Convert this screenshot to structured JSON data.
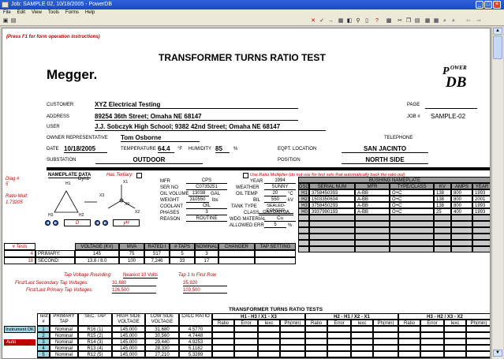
{
  "window": {
    "title": "Job: SAMPLE 02, 10/18/2005 - PowerDB"
  },
  "menu": [
    "File",
    "Edit",
    "View",
    "Tools",
    "Forms",
    "Help"
  ],
  "form": {
    "instructions": "(Press F1 for form operation instructions)",
    "brand": "Megger.",
    "title": "TRANSFORMER TURNS RATIO TEST",
    "page_label": "PAGE",
    "jobno_label": "JOB #",
    "jobno": "SAMPLE-02",
    "customer_label": "CUSTOMER",
    "customer": "XYZ Electrical Testing",
    "address_label": "ADDRESS",
    "address": "89254 36th Street;  Omaha NE 68147",
    "user_label": "USER",
    "user": "J.J. Sobczyk High School; 9382 42nd Street;  Omaha NE 68147",
    "owner_label": "OWNER REPRESENTATIVE",
    "owner": "Tom Osborne",
    "telephone_label": "TELEPHONE",
    "date_label": "DATE",
    "date": "10/18/2005",
    "temp_label": "TEMPERATURE",
    "temp": "64.4",
    "temp_unit": "°F",
    "humidity_label": "HUMIDITY",
    "humidity": "85",
    "humidity_unit": "%",
    "eqpt_label": "EQPT. LOCATION",
    "eqpt": "SAN JACINTO",
    "substation_label": "SUBSTATION",
    "substation": "OUTDOOR",
    "position_label": "POSITION",
    "position": "NORTH SIDE"
  },
  "nameplate": {
    "header": "NAMEPLATE DATA",
    "has_tertiary": "Has Tertiary:",
    "diag_label": "Diag #:",
    "diag": "5",
    "ratio_mult_label": "Ratio Mult:",
    "ratio_mult": "1.73205",
    "dyn": "Dyn1",
    "x1": "X1",
    "x2": "X2",
    "x3": "X3",
    "x0": "X0",
    "h1": "H1",
    "h2": "H2",
    "h3": "H3",
    "conn_left": "D",
    "conn_right": "yH",
    "fields": [
      {
        "label": "MFR",
        "value": "CPS"
      },
      {
        "label": "SER NO",
        "value": "C0735251"
      },
      {
        "label": "OIL VOLUME",
        "value": "13038",
        "unit": "GAL"
      },
      {
        "label": "WEIGHT",
        "value": "310550",
        "unit": "lbs"
      },
      {
        "label": "COOLANT",
        "value": "OIL"
      },
      {
        "label": "PHASES",
        "value": "3"
      },
      {
        "label": "REASON",
        "value": "ROUTINE"
      }
    ],
    "fields2": [
      {
        "label": "YEAR",
        "value": "1994"
      },
      {
        "label": "WEATHER",
        "value": "SUNNY"
      },
      {
        "label": "OIL TEMP",
        "value": "20",
        "unit": "°C"
      },
      {
        "label": "BIL",
        "value": "550",
        "unit": "kV"
      },
      {
        "label": "TANK TYPE",
        "value": "SEALED-CONSER."
      },
      {
        "label": "CLASS",
        "value": "OA/FOA/FOA"
      },
      {
        "label": "WDG MATERIAL",
        "value": "Cu"
      },
      {
        "label": "ALLOWED ERR",
        "value": "5",
        "unit": "%"
      }
    ],
    "ratio_mult_note": "Use Ratio Multiplier (do not use for test sets that automatically back the ratio out)"
  },
  "bushing": {
    "title": "BUSHING NAMEPLATE",
    "headers": [
      "DSG",
      "SERIAL NUM",
      "MFR",
      "TYPE/CLASS",
      "KV",
      "AMPS",
      "YEAR"
    ],
    "rows": [
      [
        "H1",
        "3758450393",
        "A-BB",
        "O+C",
        "138",
        "800",
        "1993"
      ],
      [
        "H2",
        "1503350604",
        "A-BB",
        "O+C",
        "138",
        "800",
        "2001"
      ],
      [
        "H3",
        "3758450293",
        "A-BB",
        "O+C",
        "138",
        "800",
        "1993"
      ],
      [
        "H0",
        "3937990193",
        "A-BB",
        "O+C",
        "25",
        "400",
        "1993"
      ]
    ]
  },
  "tests_table": {
    "headers": [
      "# Tests",
      "VOLTAGE (KV)",
      "MVA",
      "RATED I",
      "# TAPS",
      "NOMINAL",
      "CHANGER",
      "TAP SETTING"
    ],
    "rows": [
      [
        "4",
        "PRIMARY:",
        "145",
        "75",
        "517",
        "5",
        "3",
        ""
      ],
      [
        "18",
        "SECOND:",
        "13.8  /  8.0",
        "100",
        "7,246",
        "33",
        "17",
        ""
      ]
    ]
  },
  "tap": {
    "rounding_label": "Tap Voltage Rounding:",
    "rounding": "Nearest  10  Volts",
    "tap1_label": "Tap 1 Is First Row",
    "secondary_label": "First/Last Secondary Tap Voltages:",
    "sec_first": "31,680",
    "sec_last": "25,920",
    "primary_label": "First/Last Primary Tap Voltages:",
    "pri_first": "126,500",
    "pri_last": "103,500"
  },
  "ttr": {
    "title": "TRANSFORMER TURNS RATIO TESTS",
    "col_headers": [
      "Test #",
      "PRIMARY TAP",
      "SEC. TAP",
      "HIGH SIDE VOLTAGE",
      "LOW SIDE VOLTAGE",
      "CALC RATIO"
    ],
    "phase_groups": [
      "H1 - H3 / X1 - X3",
      "H2 - H1 / X2 - X1",
      "H3 - H2 / X3 - X2"
    ],
    "sub_headers": [
      "Ratio",
      "Error",
      "Iexc",
      "Ph(min)"
    ],
    "instrument": "Instrument OK",
    "auto": "Auto",
    "rows": [
      [
        "1",
        "Nominal",
        "R16 (1)",
        "145,000",
        "31,680",
        "4.5770"
      ],
      [
        "2",
        "Nominal",
        "R15 (2)",
        "145,000",
        "30,560",
        "4.7448"
      ],
      [
        "3",
        "Nominal",
        "R14 (3)",
        "145,000",
        "29,440",
        "4.9253"
      ],
      [
        "4",
        "Nominal",
        "R13 (4)",
        "145,000",
        "28,330",
        "5.1182"
      ],
      [
        "5",
        "Nominal",
        "R12 (5)",
        "145,000",
        "27,210",
        "5.3289"
      ],
      [
        "6",
        "Nominal",
        "R11 (6)",
        "145,000",
        "26,090",
        "5.5577"
      ],
      [
        "7",
        "Nominal",
        "R10 (7)",
        "145,000",
        "24,970",
        "5.8070"
      ]
    ]
  },
  "colors": {
    "accent": "#c00000",
    "titlebar": "#1b49c6",
    "highlight": "#9ed6e5"
  }
}
